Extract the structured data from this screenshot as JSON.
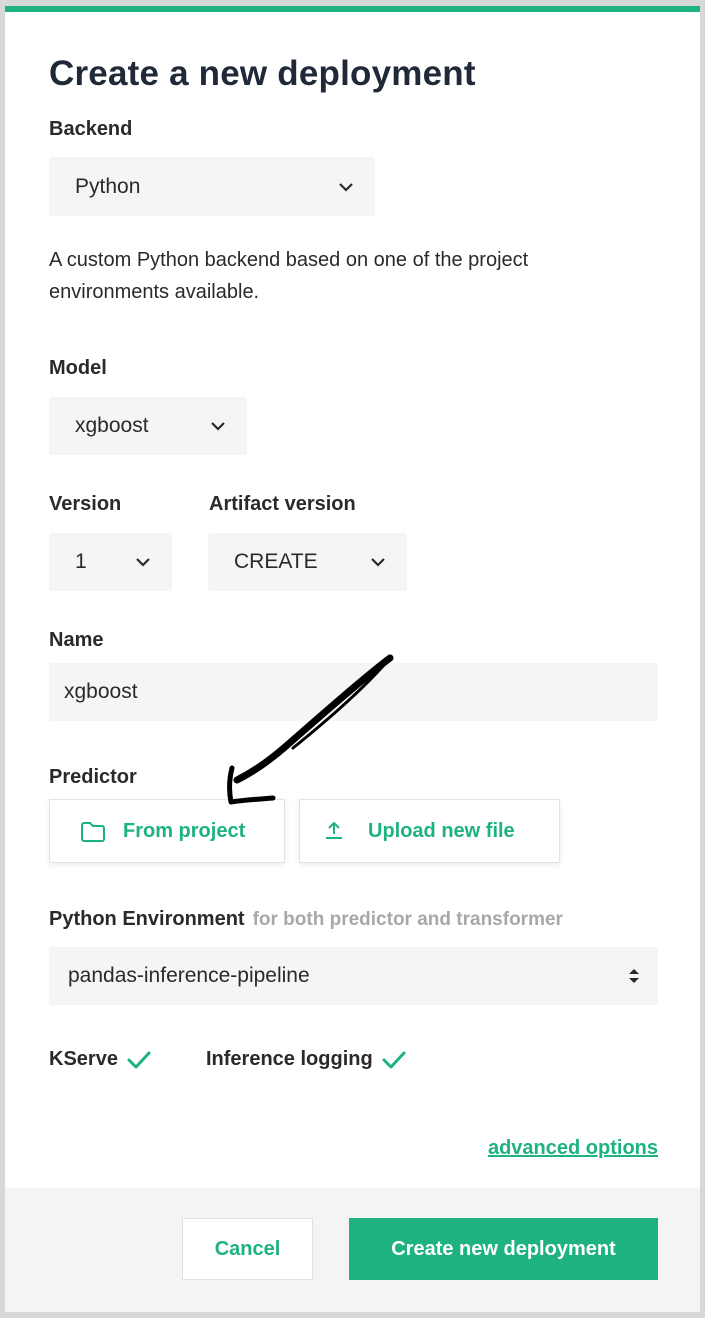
{
  "dialog": {
    "title": "Create a new deployment"
  },
  "backend": {
    "label": "Backend",
    "value": "Python",
    "description": "A custom Python backend based on one of the project environments available."
  },
  "model": {
    "label": "Model",
    "value": "xgboost"
  },
  "version": {
    "label": "Version",
    "value": "1"
  },
  "artifact_version": {
    "label": "Artifact version",
    "value": "CREATE"
  },
  "name": {
    "label": "Name",
    "value": "xgboost"
  },
  "predictor": {
    "label": "Predictor",
    "from_project_label": "From project",
    "upload_label": "Upload new file"
  },
  "environment": {
    "label": "Python Environment",
    "sublabel": "for both predictor and transformer",
    "value": "pandas-inference-pipeline"
  },
  "features": {
    "kserve_label": "KServe",
    "inference_logging_label": "Inference logging"
  },
  "advanced_link": "advanced options",
  "footer": {
    "cancel_label": "Cancel",
    "create_label": "Create new deployment"
  },
  "colors": {
    "accent": "#1eb182",
    "field_bg": "#f5f5f5",
    "footer_bg": "#f4f4f4"
  }
}
